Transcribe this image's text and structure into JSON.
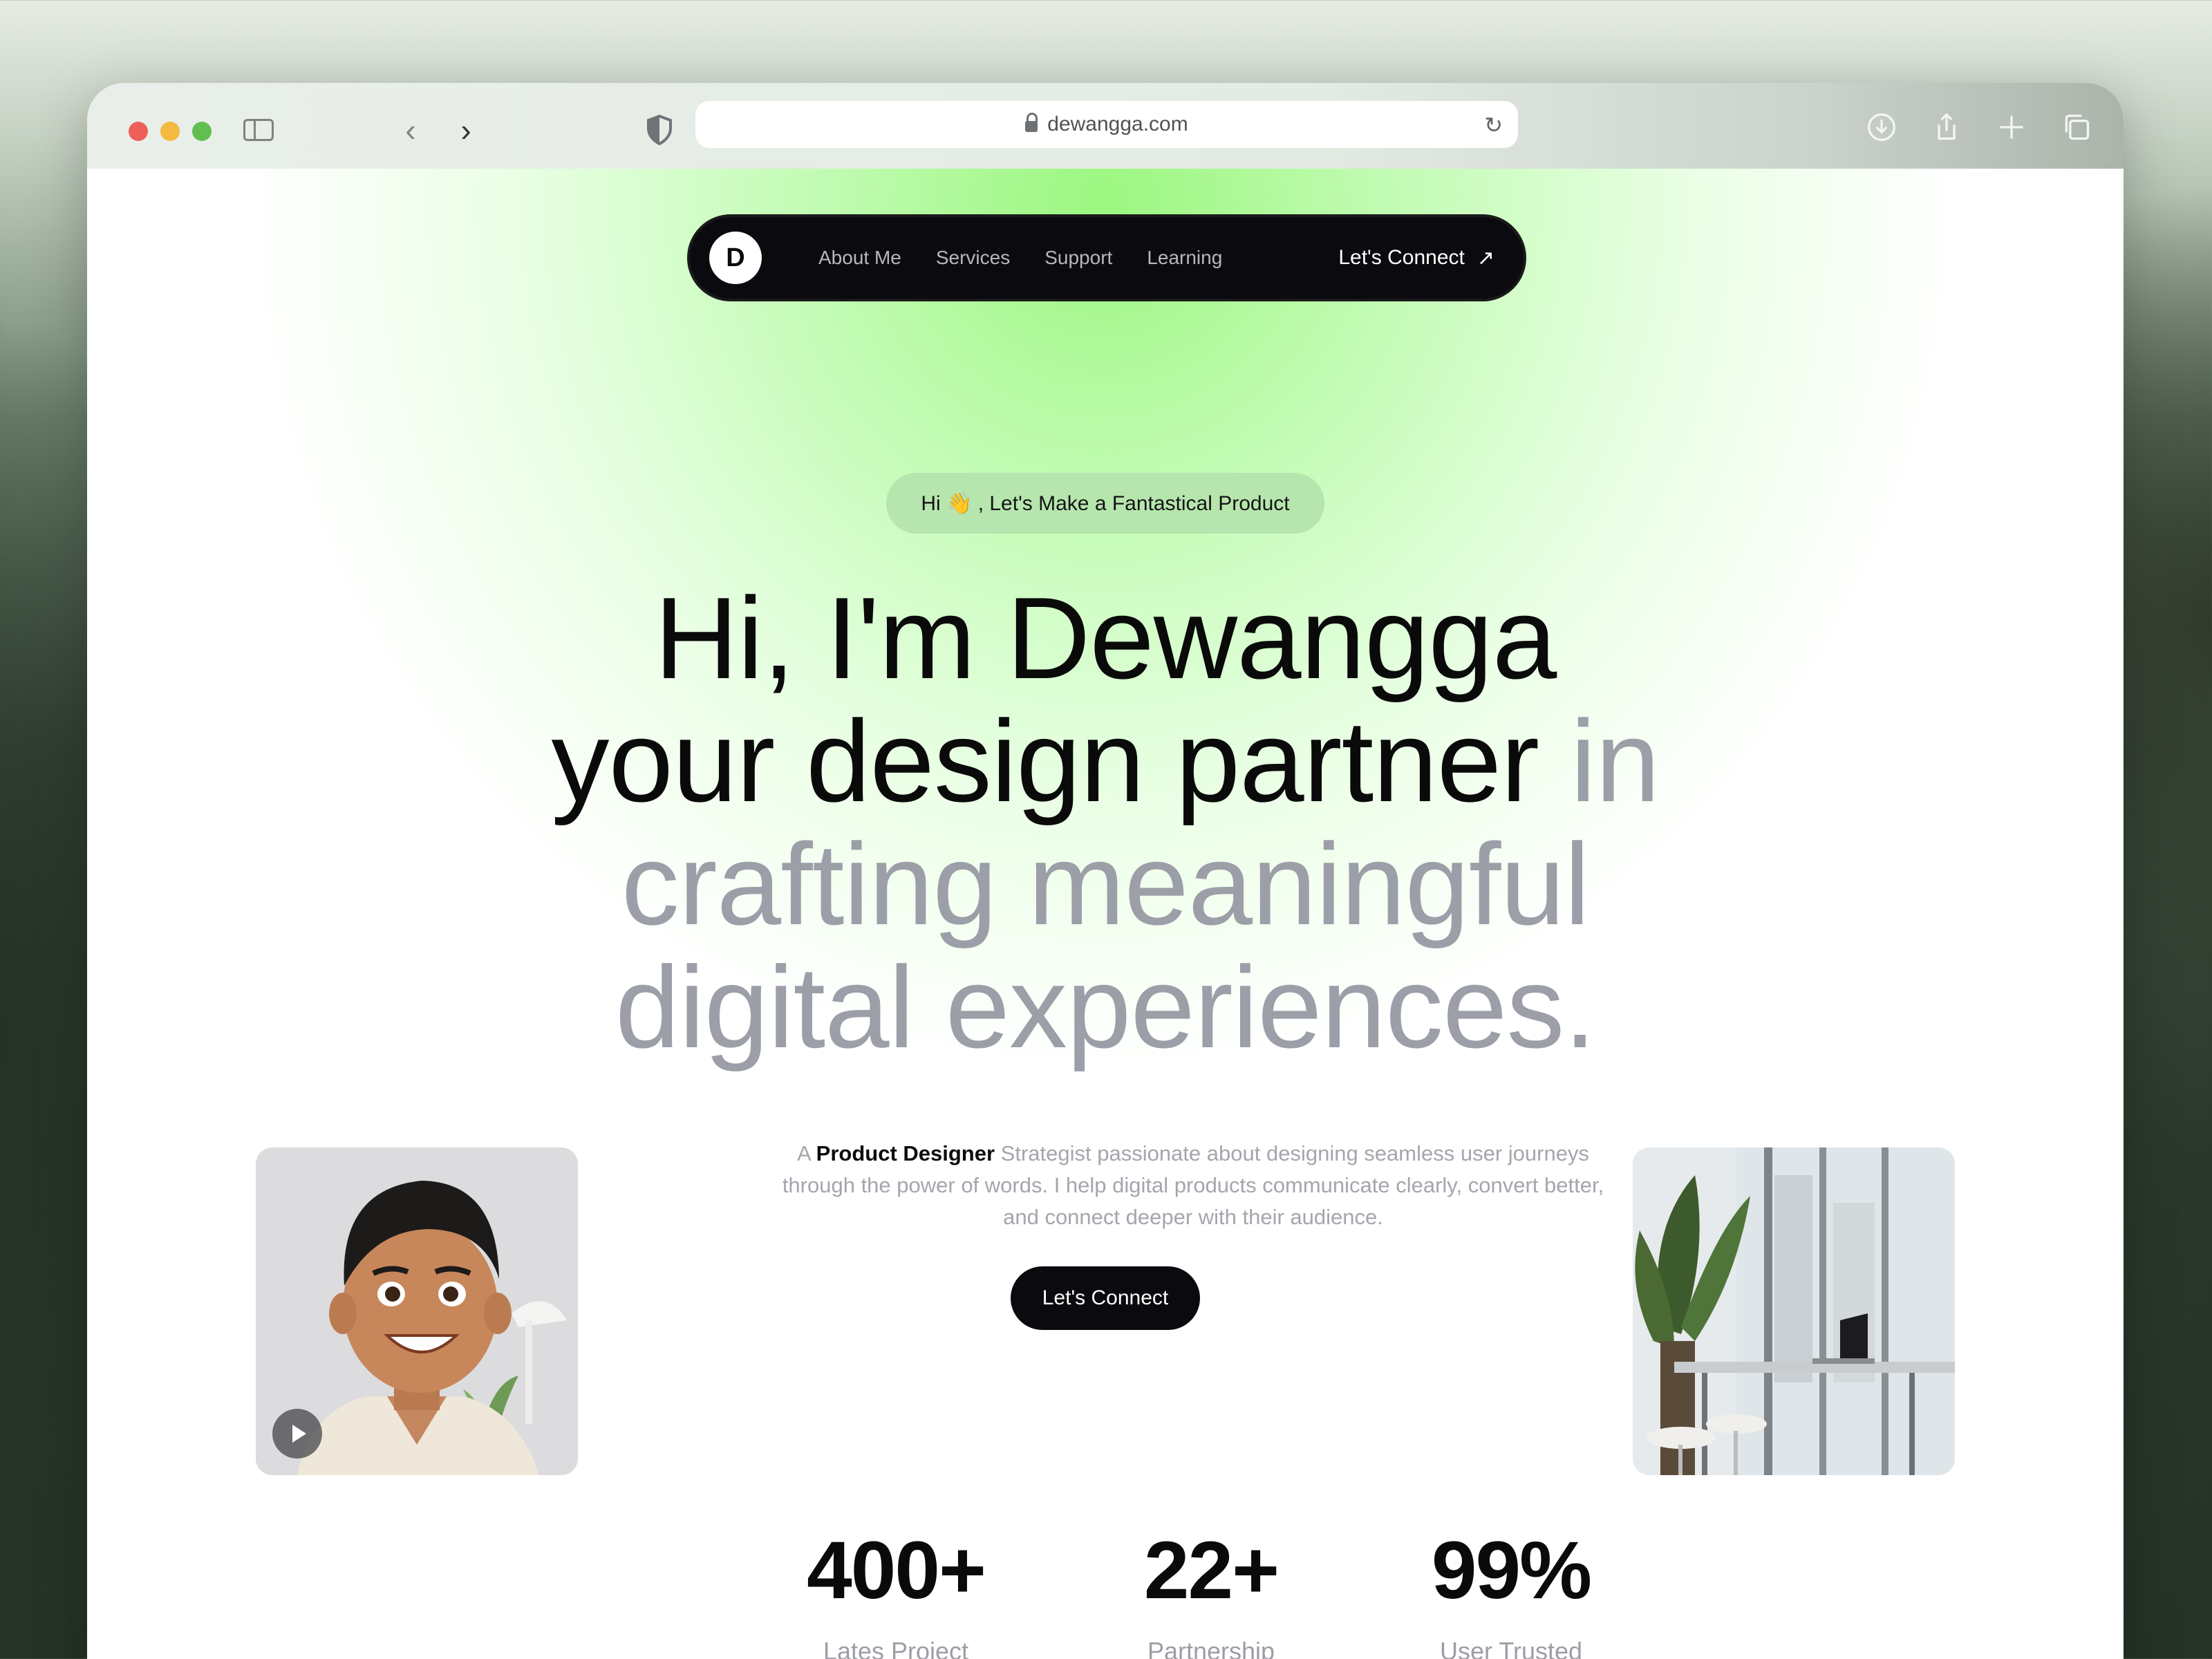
{
  "browser": {
    "url": "dewangga.com"
  },
  "nav": {
    "logo": "D",
    "links": [
      "About Me",
      "Services",
      "Support",
      "Learning"
    ],
    "cta": "Let's Connect"
  },
  "hero": {
    "pill": "Hi 👋 , Let's Make a Fantastical Product",
    "line1": "Hi, I'm Dewangga",
    "line2_dark": "your design partner",
    "line2_gray": " in",
    "line3": "crafting meaningful",
    "line4": "digital experiences.",
    "desc_prefix": "A ",
    "desc_bold": "Product Designer",
    "desc_rest": " Strategist passionate about designing seamless user journeys through the power of words. I help digital products communicate clearly, convert better, and connect deeper with their audience.",
    "cta": "Let's Connect"
  },
  "stats": [
    {
      "value": "400+",
      "label": "Lates Project"
    },
    {
      "value": "22+",
      "label": "Partnership"
    },
    {
      "value": "99%",
      "label": "User Trusted"
    }
  ],
  "colors": {
    "accent_green": "#9af67a",
    "dark": "#0b0b0f",
    "muted_text": "#9c9ea8"
  }
}
